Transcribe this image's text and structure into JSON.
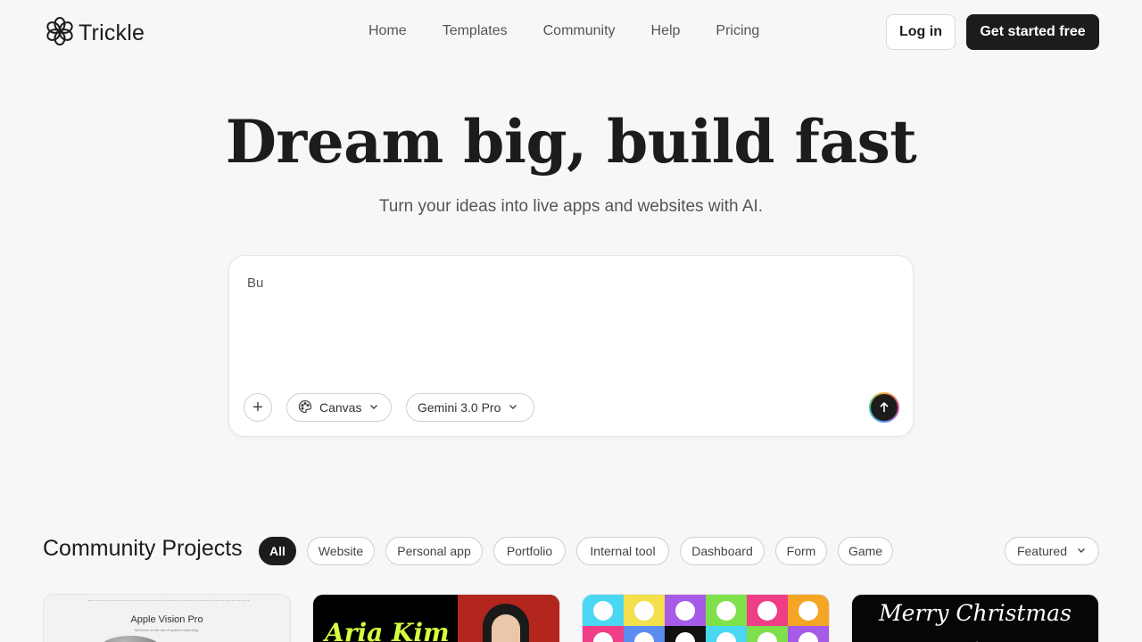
{
  "brand": {
    "name": "Trickle"
  },
  "nav": {
    "items": [
      {
        "label": "Home"
      },
      {
        "label": "Templates"
      },
      {
        "label": "Community"
      },
      {
        "label": "Help"
      },
      {
        "label": "Pricing"
      }
    ]
  },
  "auth": {
    "login_label": "Log in",
    "cta_label": "Get started free"
  },
  "hero": {
    "title": "Dream big, build fast",
    "subtitle": "Turn your ideas into live apps and websites with AI."
  },
  "prompt": {
    "value": "Bu",
    "add_label": "+",
    "mode_label": "Canvas",
    "model_label": "Gemini 3.0 Pro"
  },
  "community": {
    "title": "Community Projects",
    "filters": [
      {
        "label": "All",
        "active": true
      },
      {
        "label": "Website"
      },
      {
        "label": "Personal app"
      },
      {
        "label": "Portfolio"
      },
      {
        "label": "Internal tool"
      },
      {
        "label": "Dashboard"
      },
      {
        "label": "Form"
      },
      {
        "label": "Game"
      }
    ],
    "sort_label": "Featured",
    "cards": [
      {
        "title": "Apple Vision Pro",
        "subtitle": "Welcome to the era of spatial computing."
      },
      {
        "title": "Aria Kim"
      },
      {
        "title": ""
      },
      {
        "title": "Merry Christmas"
      }
    ]
  },
  "colors": {
    "primary": "#1c1c1c",
    "background": "#f7f7f7",
    "card2_accent": "#d6ff3f",
    "card3_bg": "#4ad7f2"
  },
  "icons": {
    "logo": "flower-logo-icon",
    "mode": "palette-icon",
    "dropdown": "chevron-down-icon",
    "send": "arrow-up-icon",
    "add": "plus-icon"
  }
}
